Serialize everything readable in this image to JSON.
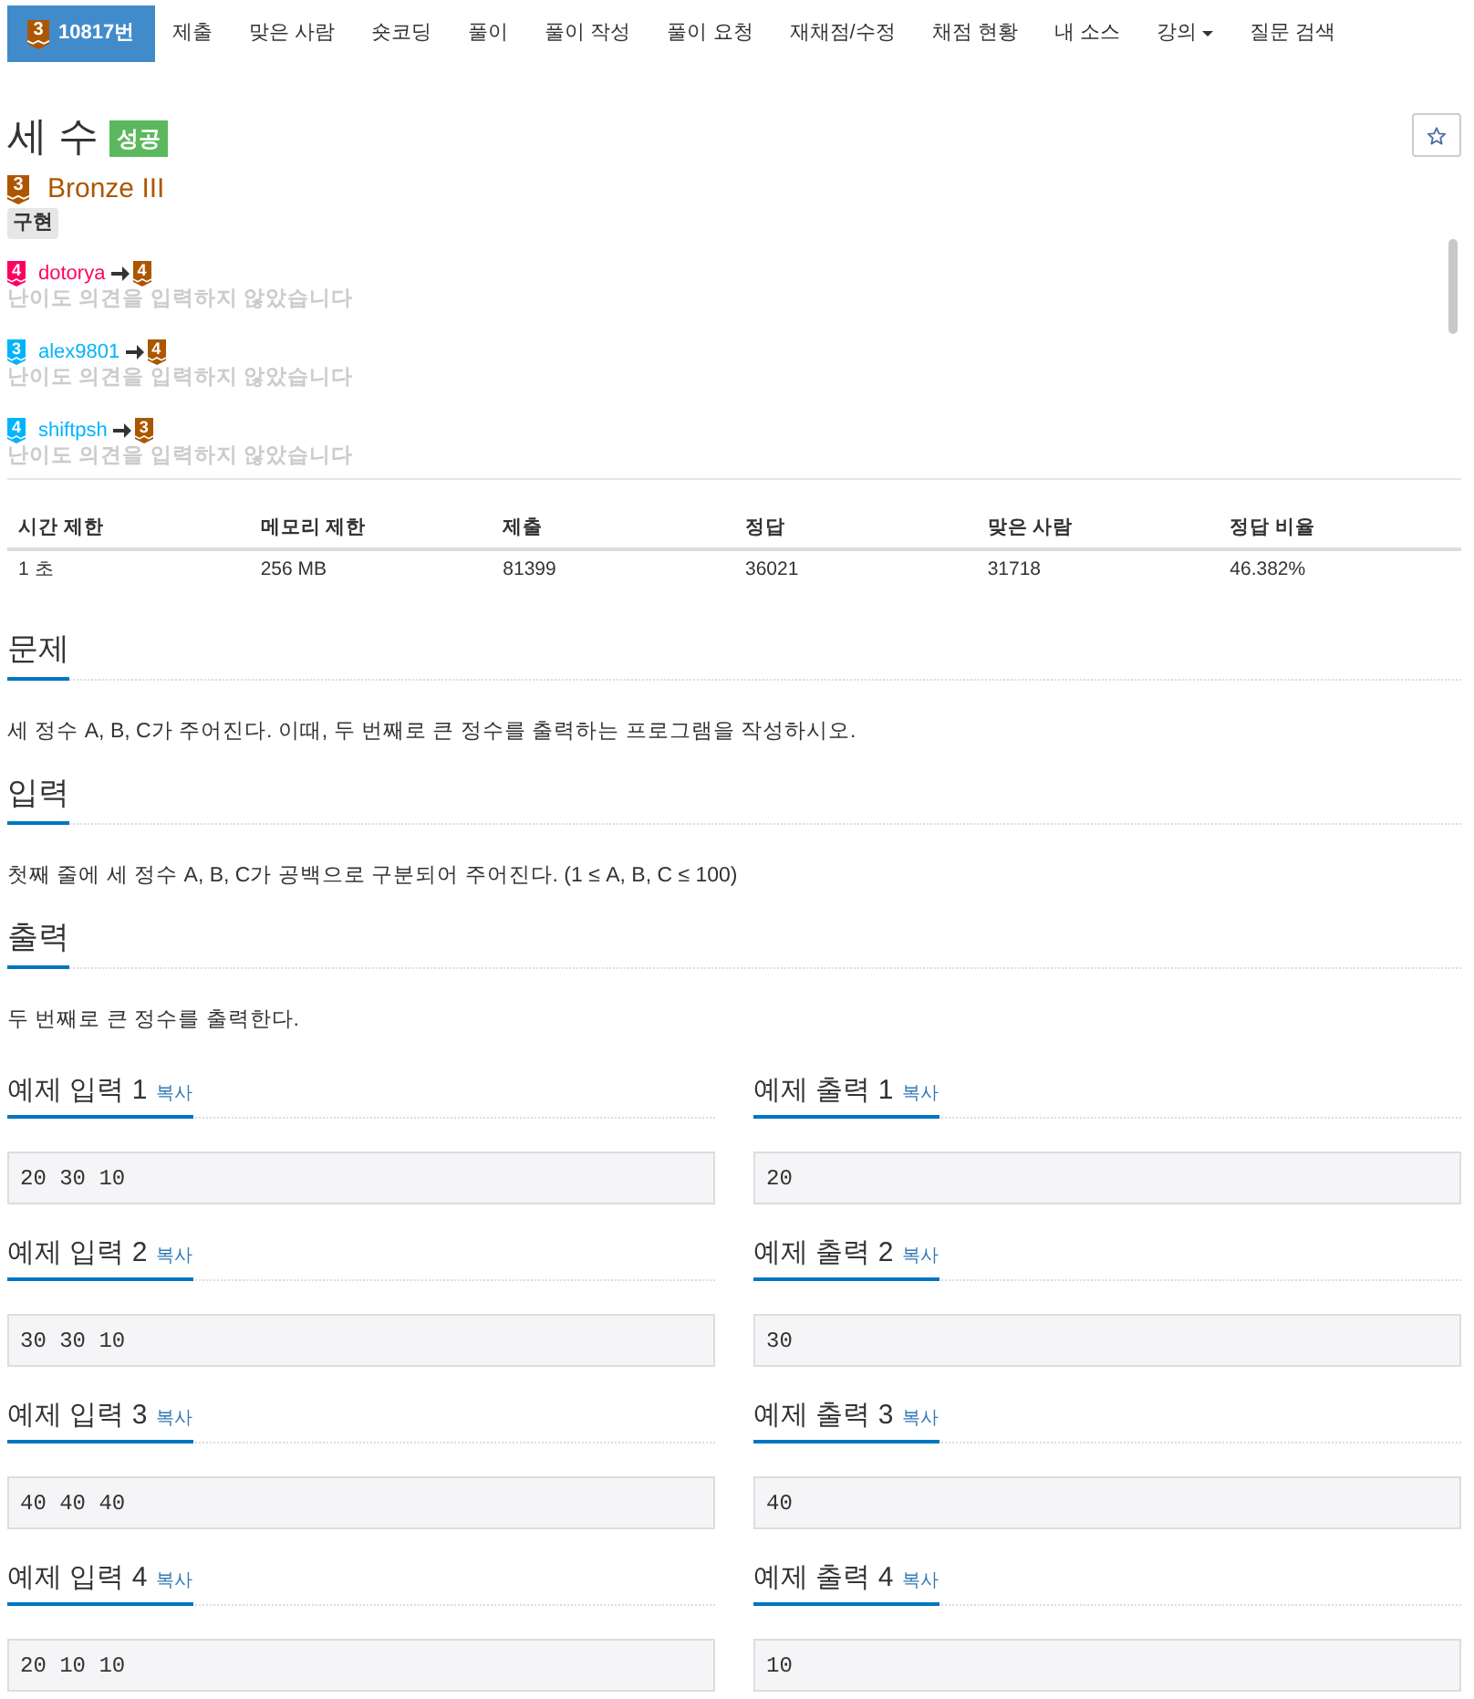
{
  "nav": {
    "items": [
      {
        "kind": "problem",
        "label": "10817번",
        "tier": "3",
        "selected": true
      },
      {
        "kind": "link",
        "label": "제출",
        "selected": false
      },
      {
        "kind": "link",
        "label": "맞은 사람",
        "selected": false
      },
      {
        "kind": "link",
        "label": "숏코딩",
        "selected": false
      },
      {
        "kind": "link",
        "label": "풀이",
        "selected": false
      },
      {
        "kind": "link",
        "label": "풀이 작성",
        "selected": false
      },
      {
        "kind": "link",
        "label": "풀이 요청",
        "selected": false
      },
      {
        "kind": "link",
        "label": "재채점/수정",
        "selected": false
      },
      {
        "kind": "link",
        "label": "채점 현황",
        "selected": false
      },
      {
        "kind": "link",
        "label": "내 소스",
        "selected": false
      },
      {
        "kind": "dropdown",
        "label": "강의",
        "selected": false
      },
      {
        "kind": "link",
        "label": "질문 검색",
        "selected": false
      }
    ]
  },
  "problem": {
    "title": "세 수",
    "result": "성공",
    "tier": {
      "number": "3",
      "label": "Bronze III"
    },
    "tags": [
      "구현"
    ]
  },
  "difficulty_opinions": [
    {
      "user": "dotorya",
      "user_tier": "4",
      "color": "#ff0062",
      "voted_tier": "4",
      "comment": "난이도 의견을 입력하지 않았습니다"
    },
    {
      "user": "alex9801",
      "user_tier": "3",
      "color": "#00b4fc",
      "voted_tier": "4",
      "comment": "난이도 의견을 입력하지 않았습니다"
    },
    {
      "user": "shiftpsh",
      "user_tier": "4",
      "color": "#00b4fc",
      "voted_tier": "3",
      "comment": "난이도 의견을 입력하지 않았습니다"
    }
  ],
  "stats": {
    "columns": [
      "시간 제한",
      "메모리 제한",
      "제출",
      "정답",
      "맞은 사람",
      "정답 비율"
    ],
    "rows": [
      [
        "1 초",
        "256 MB",
        "81399",
        "36021",
        "31718",
        "46.382%"
      ]
    ]
  },
  "sections": [
    {
      "heading": "문제",
      "text": "세 정수 A, B, C가 주어진다. 이때, 두 번째로 큰 정수를 출력하는 프로그램을 작성하시오."
    },
    {
      "heading": "입력",
      "text": "첫째 줄에 세 정수 A, B, C가 공백으로 구분되어 주어진다. (1 ≤ A, B, C ≤ 100)"
    },
    {
      "heading": "출력",
      "text": "두 번째로 큰 정수를 출력한다."
    }
  ],
  "samples": [
    {
      "input": {
        "title": "예제 입력 1",
        "copy": "복사",
        "value": "20 30 10"
      },
      "output": {
        "title": "예제 출력 1",
        "copy": "복사",
        "value": "20"
      }
    },
    {
      "input": {
        "title": "예제 입력 2",
        "copy": "복사",
        "value": "30 30 10"
      },
      "output": {
        "title": "예제 출력 2",
        "copy": "복사",
        "value": "30"
      }
    },
    {
      "input": {
        "title": "예제 입력 3",
        "copy": "복사",
        "value": "40 40 40"
      },
      "output": {
        "title": "예제 출력 3",
        "copy": "복사",
        "value": "40"
      }
    },
    {
      "input": {
        "title": "예제 입력 4",
        "copy": "복사",
        "value": "20 10 10"
      },
      "output": {
        "title": "예제 출력 4",
        "copy": "복사",
        "value": "10"
      }
    }
  ]
}
